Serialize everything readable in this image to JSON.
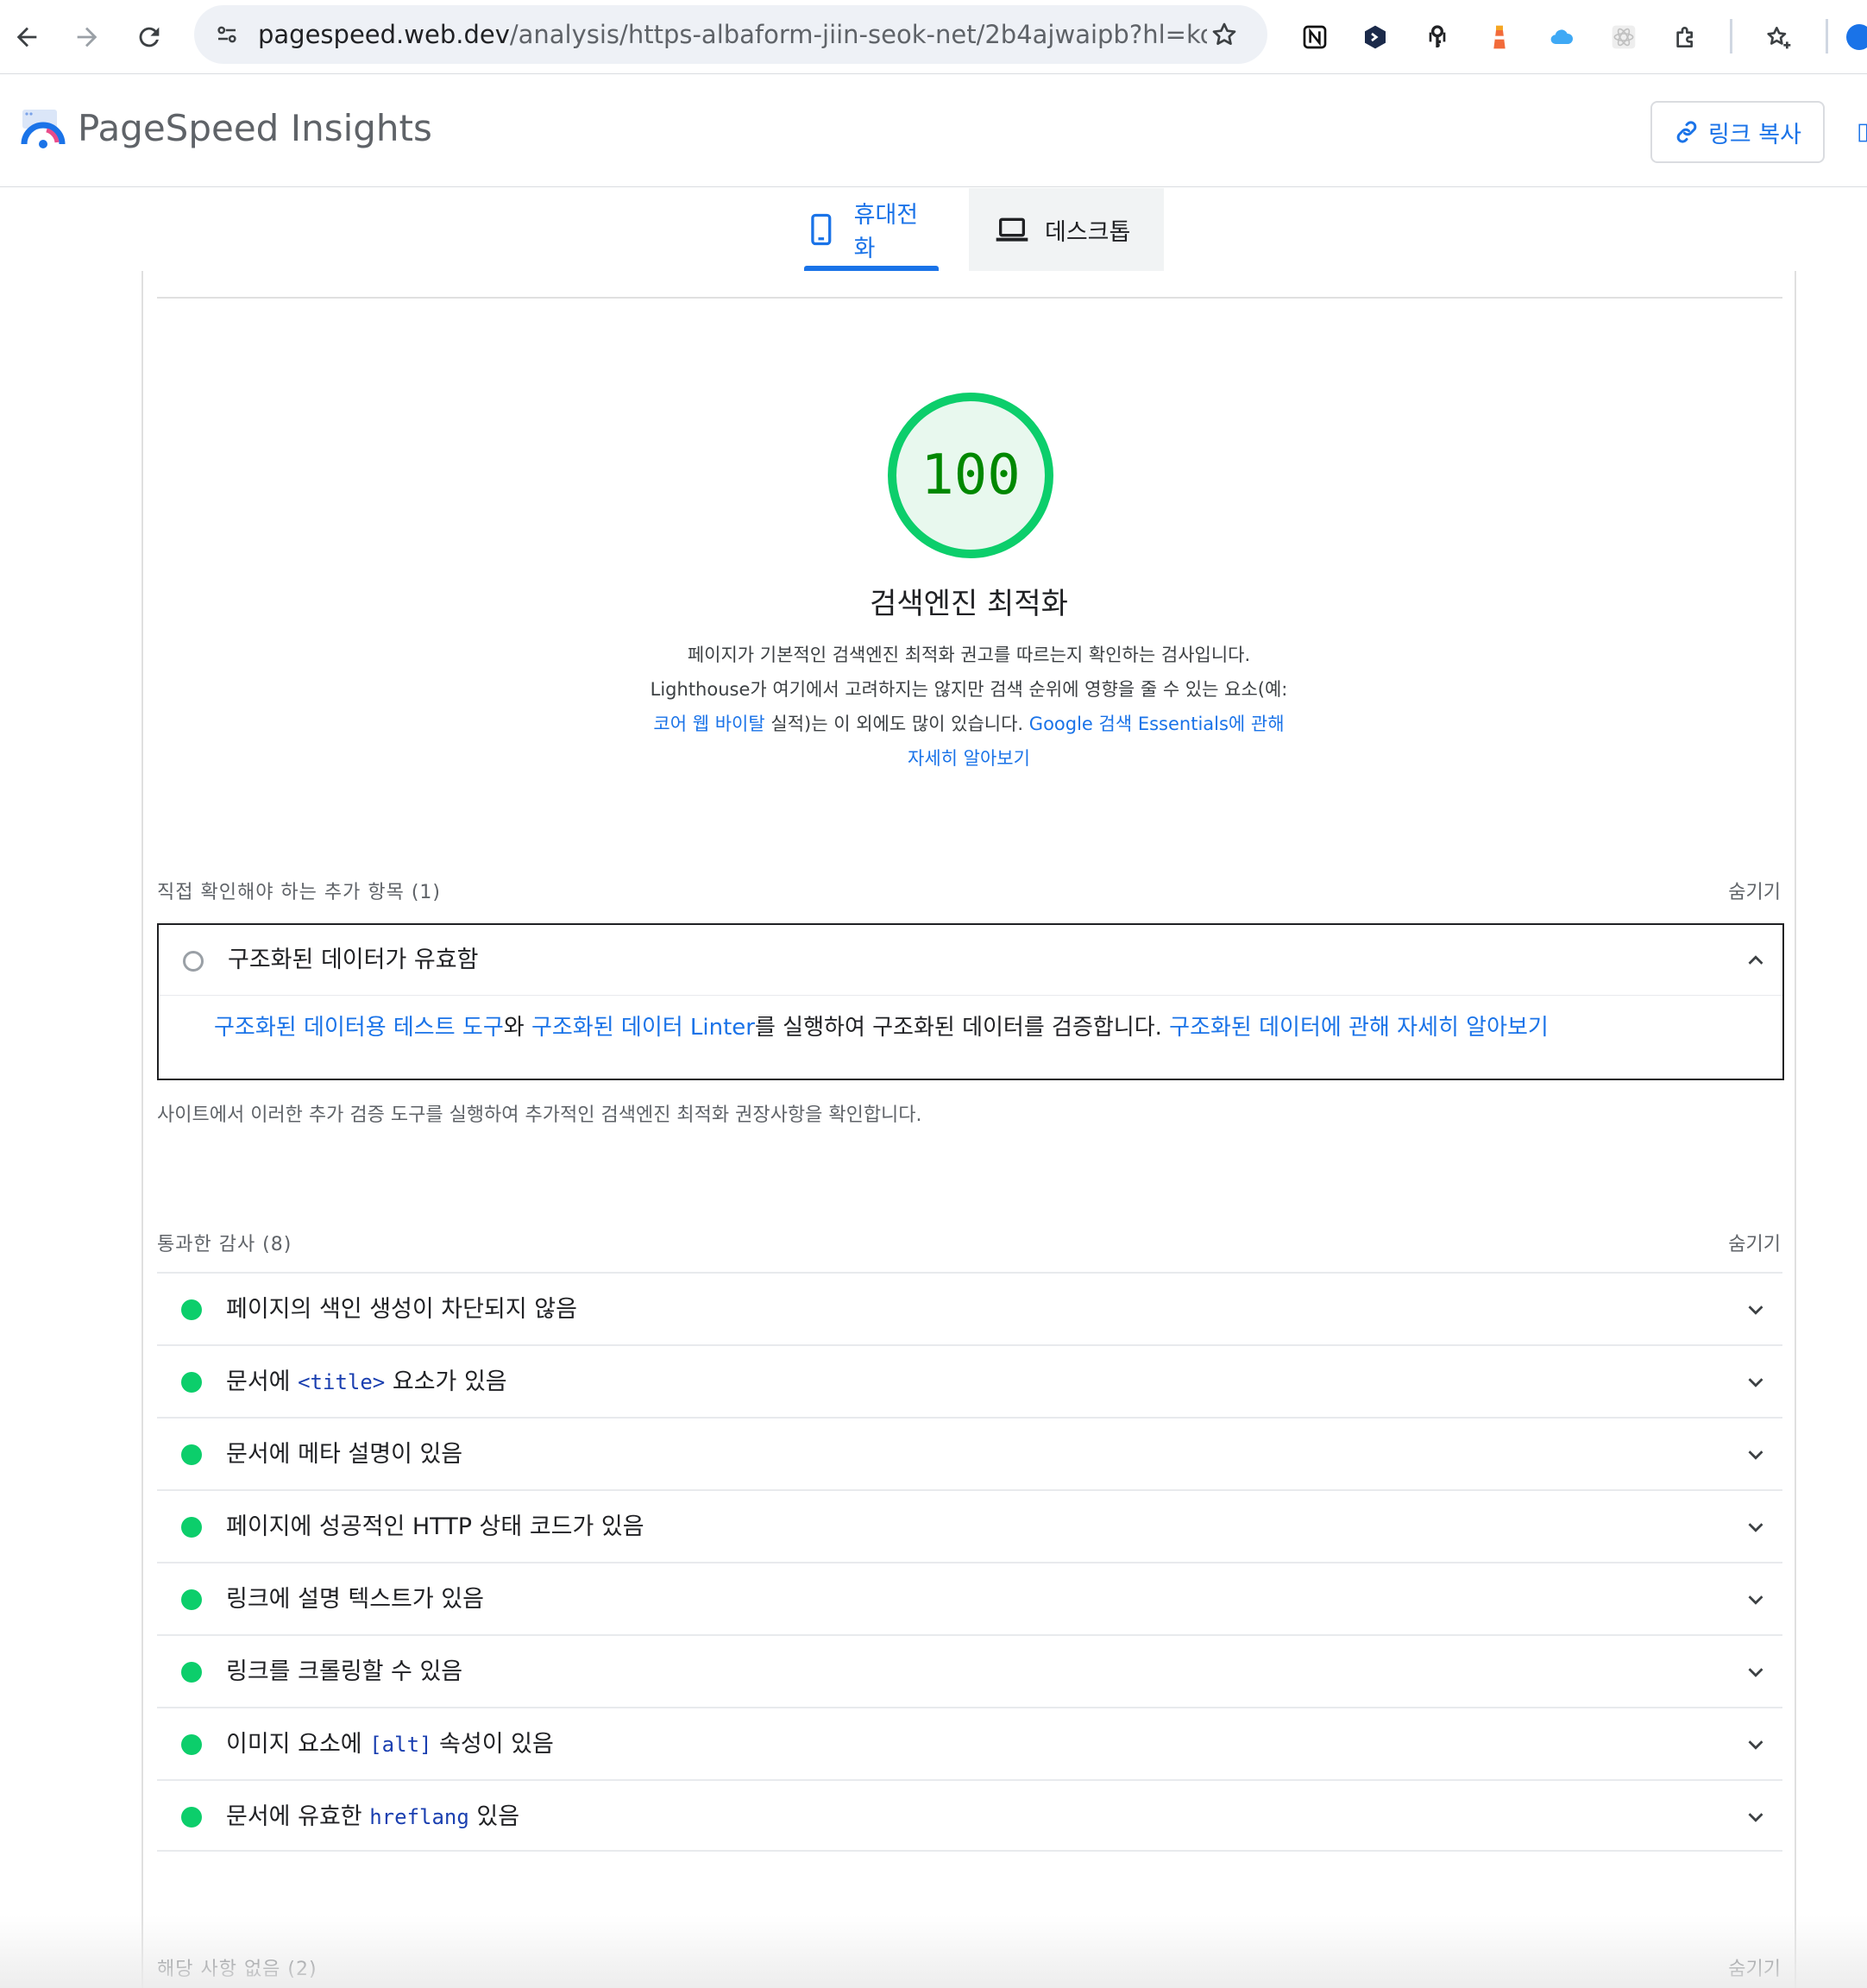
{
  "browser": {
    "url_host": "pagespeed.web.dev",
    "url_path": "/analysis/https-albaform-jiin-seok-net/2b4ajwaipb?hl=ko&f...",
    "extensions": [
      "notion-icon",
      "hex-icon",
      "key-icon",
      "lighthouse-icon",
      "cloud-icon",
      "react-icon",
      "puzzle-icon"
    ]
  },
  "header": {
    "title": "PageSpeed Insights",
    "copy_link_label": "링크 복사"
  },
  "tabs": [
    {
      "label": "휴대전화",
      "active": true
    },
    {
      "label": "데스크톱",
      "active": false
    }
  ],
  "category": {
    "score": "100",
    "score_fraction": 1.0,
    "title": "검색엔진 최적화",
    "desc_1": "페이지가 기본적인 검색엔진 최적화 권고를 따르는지 확인하는 검사입니다.",
    "desc_2": "Lighthouse가 여기에서 고려하지는 않지만 검색 순위에 영향을 줄 수 있는 요소(예:",
    "desc_link_1": "코어 웹 바이탈",
    "desc_3": " 실적)는 이 외에도 많이 있습니다. ",
    "desc_link_2": "Google 검색 Essentials에 관해",
    "desc_link_3": "자세히 알아보기"
  },
  "manual": {
    "group_title": "직접 확인해야 하는 추가 항목 (1)",
    "toggle": "숨기기",
    "audit_title": "구조화된 데이터가 유효함",
    "body_link_1": "구조화된 데이터용 테스트 도구",
    "body_text_1": "와 ",
    "body_link_2": "구조화된 데이터 Linter",
    "body_text_2": "를 실행하여 구조화된 데이터를 검증합니다. ",
    "body_link_3": "구조화된 데이터에 관해 자세히 알아보기",
    "note": "사이트에서 이러한 추가 검증 도구를 실행하여 추가적인 검색엔진 최적화 권장사항을 확인합니다."
  },
  "passed": {
    "group_title": "통과한 감사 (8)",
    "toggle": "숨기기",
    "audits": [
      {
        "pre": "페이지의 색인 생성이 차단되지 않음",
        "code": "",
        "post": ""
      },
      {
        "pre": "문서에 ",
        "code": "<title>",
        "post": " 요소가 있음"
      },
      {
        "pre": "문서에 메타 설명이 있음",
        "code": "",
        "post": ""
      },
      {
        "pre": "페이지에 성공적인 HTTP 상태 코드가 있음",
        "code": "",
        "post": ""
      },
      {
        "pre": "링크에 설명 텍스트가 있음",
        "code": "",
        "post": ""
      },
      {
        "pre": "링크를 크롤링할 수 있음",
        "code": "",
        "post": ""
      },
      {
        "pre": "이미지 요소에 ",
        "code": "[alt]",
        "post": " 속성이 있음"
      },
      {
        "pre": "문서에 유효한 ",
        "code": "hreflang",
        "post": " 있음"
      }
    ]
  },
  "not_applicable": {
    "group_title": "해당 사항 없음 (2)",
    "toggle": "숨기기"
  }
}
